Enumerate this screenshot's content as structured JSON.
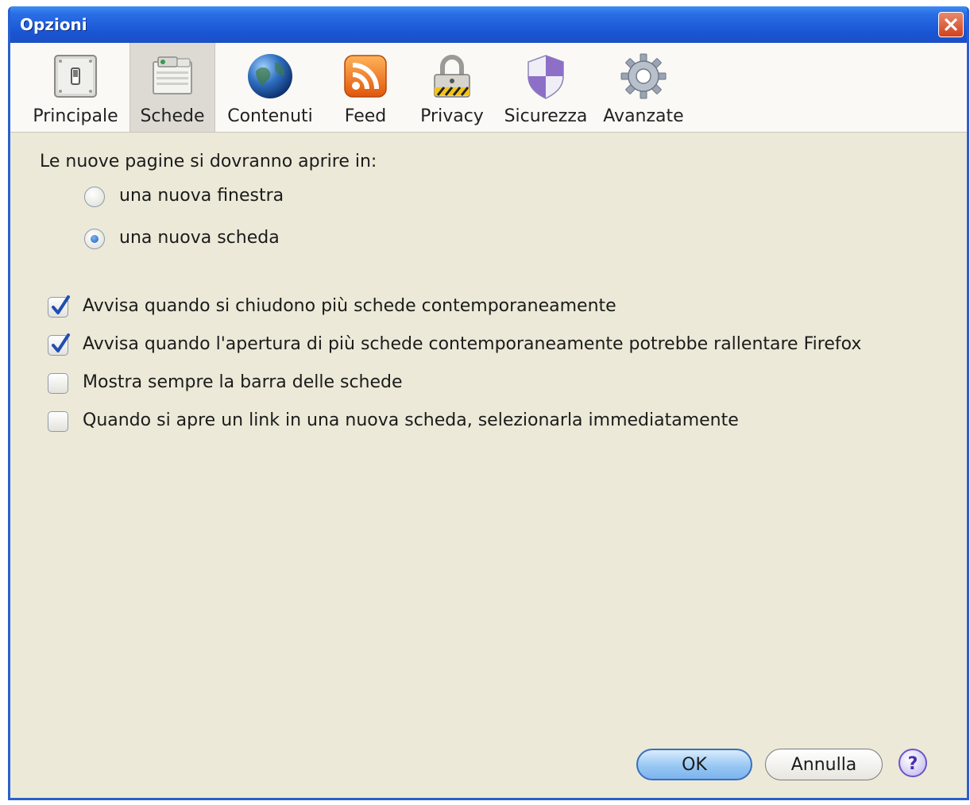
{
  "window": {
    "title": "Opzioni"
  },
  "tabs": [
    {
      "label": "Principale",
      "icon": "switch-icon",
      "selected": false
    },
    {
      "label": "Schede",
      "icon": "tabs-icon",
      "selected": true
    },
    {
      "label": "Contenuti",
      "icon": "globe-icon",
      "selected": false
    },
    {
      "label": "Feed",
      "icon": "rss-icon",
      "selected": false
    },
    {
      "label": "Privacy",
      "icon": "padlock-icon",
      "selected": false
    },
    {
      "label": "Sicurezza",
      "icon": "shield-icon",
      "selected": false
    },
    {
      "label": "Avanzate",
      "icon": "gear-icon",
      "selected": false
    }
  ],
  "open_in": {
    "label": "Le nuove pagine si dovranno aprire in:",
    "options": [
      {
        "label": "una nuova finestra",
        "selected": false
      },
      {
        "label": "una nuova scheda",
        "selected": true
      }
    ]
  },
  "checkboxes": [
    {
      "label": "Avvisa quando si chiudono più schede contemporaneamente",
      "checked": true
    },
    {
      "label": "Avvisa quando l'apertura di più schede contemporaneamente potrebbe rallentare Firefox",
      "checked": true
    },
    {
      "label": "Mostra sempre la barra delle schede",
      "checked": false
    },
    {
      "label": "Quando si apre un link in una nuova scheda, selezionarla immediatamente",
      "checked": false
    }
  ],
  "buttons": {
    "ok": "OK",
    "cancel": "Annulla",
    "help": "?"
  }
}
